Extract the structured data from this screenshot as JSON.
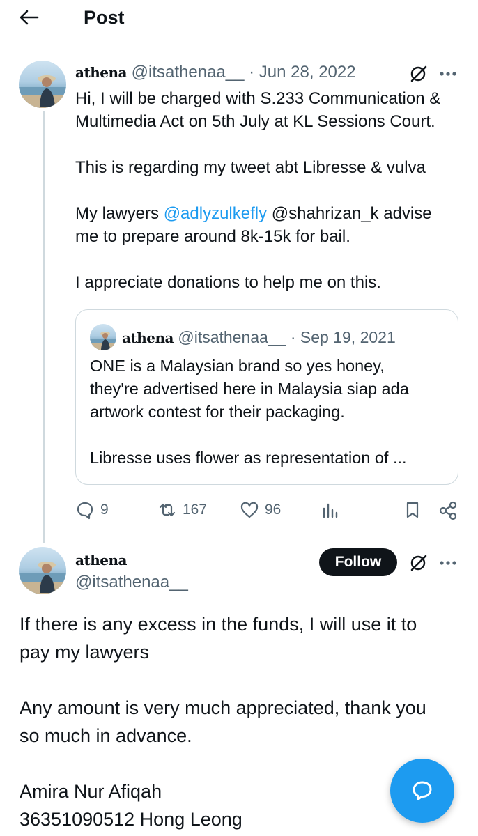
{
  "header": {
    "title": "Post",
    "back_icon": "arrow-left-icon"
  },
  "parent_post": {
    "name": "athena",
    "handle": "@itsathenaa__",
    "separator": "·",
    "date": "Jun 28, 2022",
    "lines": [
      "Hi, I will be charged with S.233 Communication &",
      "Multimedia Act on 5th July at KL Sessions Court.",
      "This is regarding my tweet abt Libresse & vulva",
      "My lawyers",
      "@adlyzulkefly",
      "@shahrizan_k advise",
      "me to prepare around 8k-15k for bail.",
      "I appreciate donations to help me on this."
    ],
    "quote": {
      "name": "athena",
      "handle": "@itsathenaa__",
      "separator": "·",
      "date": "Sep 19, 2021",
      "lines": [
        "ONE is a Malaysian brand so yes honey,",
        "they're advertised here in Malaysia siap ada",
        "artwork contest for their packaging.",
        "Libresse uses flower as representation of ..."
      ]
    },
    "actions": {
      "replies": "9",
      "reposts": "167",
      "likes": "96"
    }
  },
  "main_post": {
    "name": "athena",
    "handle": "@itsathenaa__",
    "follow_label": "Follow",
    "paragraphs": [
      "If there is any excess in the funds, I will use it to",
      "pay my lawyers",
      "Any amount is very much appreciated, thank you",
      "so much in advance.",
      "Amira Nur Afiqah",
      "36351090512 Hong Leong"
    ]
  },
  "colors": {
    "accent": "#1d9bf0",
    "text": "#0f1419",
    "muted": "#536471",
    "border": "#cfd9de"
  }
}
